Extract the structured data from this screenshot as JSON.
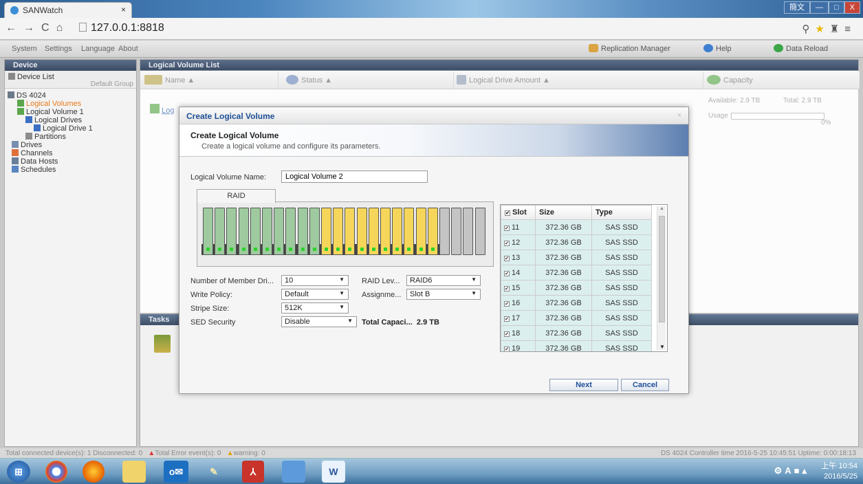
{
  "browser": {
    "tab_title": "SANWatch",
    "tab_close": "×",
    "url": "127.0.0.1:8818",
    "window_buttons": [
      "簡文",
      "—",
      "□",
      "X"
    ]
  },
  "menu": {
    "items": [
      "System",
      "Settings",
      "Language",
      "About"
    ],
    "replication": "Replication Manager",
    "help": "Help",
    "reload": "Data Reload"
  },
  "left_panel": {
    "title": "Device",
    "device_list": "Device List",
    "default_group": "Default Group",
    "tree": [
      "DS 4024",
      "Logical Volumes",
      "Logical Volume 1",
      "Logical Drives",
      "Logical Drive 1",
      "Partitions",
      "Drives",
      "Channels",
      "Data Hosts",
      "Schedules"
    ]
  },
  "main_panel": {
    "title": "Logical Volume List",
    "columns": [
      "Name ▲",
      "Status ▲",
      "Logical Drive Amount ▲",
      "Capacity"
    ],
    "row_name": "Log",
    "available": "Available: 2.9 TB",
    "total": "Total: 2.9 TB",
    "usage_label": "Usage :",
    "usage_pct": "0%"
  },
  "tasks_panel": {
    "title": "Tasks"
  },
  "dialog": {
    "title": "Create Logical Volume",
    "close": "×",
    "header_title": "Create Logical Volume",
    "header_sub": "Create a logical volume and configure its parameters.",
    "name_label": "Logical Volume Name:",
    "name_value": "Logical Volume 2",
    "raid_tab": "RAID",
    "fields": {
      "members_label": "Number of Member Dri...",
      "members_value": "10",
      "raid_label": "RAID Lev...",
      "raid_value": "RAID6",
      "write_label": "Write Policy:",
      "write_value": "Default",
      "assign_label": "Assignme...",
      "assign_value": "Slot B",
      "stripe_label": "Stripe Size:",
      "stripe_value": "512K",
      "sed_label": "SED Security",
      "sed_value": "Disable",
      "total_label": "Total Capaci...",
      "total_value": "2.9 TB"
    },
    "table_headers": [
      "Slot",
      "Size",
      "Type"
    ],
    "rows": [
      {
        "slot": "11",
        "size": "372.36 GB",
        "type": "SAS SSD"
      },
      {
        "slot": "12",
        "size": "372.36 GB",
        "type": "SAS SSD"
      },
      {
        "slot": "13",
        "size": "372.36 GB",
        "type": "SAS SSD"
      },
      {
        "slot": "14",
        "size": "372.36 GB",
        "type": "SAS SSD"
      },
      {
        "slot": "15",
        "size": "372.36 GB",
        "type": "SAS SSD"
      },
      {
        "slot": "16",
        "size": "372.36 GB",
        "type": "SAS SSD"
      },
      {
        "slot": "17",
        "size": "372.36 GB",
        "type": "SAS SSD"
      },
      {
        "slot": "18",
        "size": "372.36 GB",
        "type": "SAS SSD"
      },
      {
        "slot": "19",
        "size": "372.36 GB",
        "type": "SAS SSD"
      }
    ],
    "next": "Next",
    "cancel": "Cancel"
  },
  "drive_slots": [
    "green",
    "green",
    "green",
    "green",
    "green",
    "green",
    "green",
    "green",
    "green",
    "green",
    "yellow",
    "yellow",
    "yellow",
    "yellow",
    "yellow",
    "yellow",
    "yellow",
    "yellow",
    "yellow",
    "yellow",
    "gray",
    "gray",
    "gray",
    "gray"
  ],
  "colors": {
    "slot_green": "#9fca9f",
    "slot_yellow": "#f6d65a",
    "slot_gray": "#c4c4c4"
  },
  "status_bar": {
    "left": "Total connected device(s): 1   Disconnected: 0",
    "errors": "Total Error event(s): 0",
    "warnings": "warning: 0",
    "right": "DS 4024  Controller time  2016-5-25 10:45:51  Uptime: 0:00:18:13"
  },
  "taskbar": {
    "tray": "A",
    "time": "上午 10:54",
    "date": "2016/5/25"
  }
}
